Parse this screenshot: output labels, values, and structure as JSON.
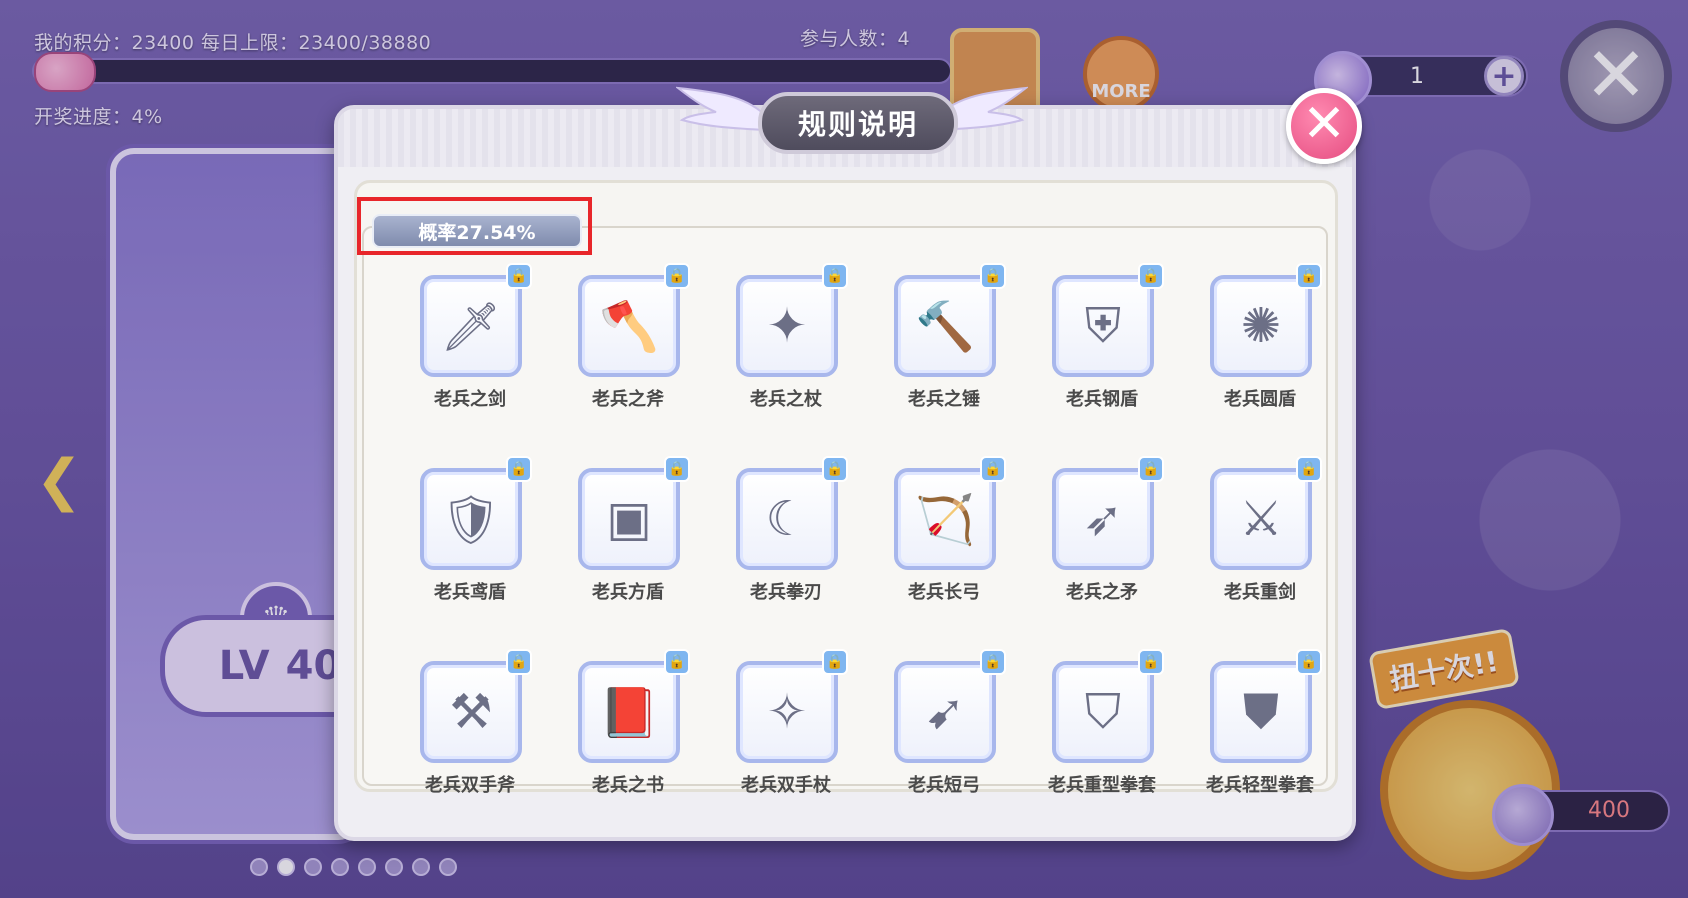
{
  "hud": {
    "score_text": "我的积分：23400 每日上限：23400/38880",
    "participants_text": "参与人数：4",
    "lottery_progress_text": "开奖进度：4%",
    "lottery_progress": 0.04,
    "more_label": "MORE",
    "currency_count": "1",
    "lv_label": "LV",
    "lv_value": "40",
    "ten_draw_label": "扭十次!!",
    "cost_value": "400"
  },
  "modal": {
    "title": "规则说明",
    "probability_label": "概率27.54%",
    "items": [
      {
        "name": "老兵之剑",
        "icon": "sword-icon"
      },
      {
        "name": "老兵之斧",
        "icon": "axe-icon"
      },
      {
        "name": "老兵之杖",
        "icon": "staff-icon"
      },
      {
        "name": "老兵之锤",
        "icon": "hammer-icon"
      },
      {
        "name": "老兵钢盾",
        "icon": "steel-shield-icon"
      },
      {
        "name": "老兵圆盾",
        "icon": "round-shield-icon"
      },
      {
        "name": "老兵鸢盾",
        "icon": "kite-shield-icon"
      },
      {
        "name": "老兵方盾",
        "icon": "square-shield-icon"
      },
      {
        "name": "老兵拳刃",
        "icon": "fist-blade-icon"
      },
      {
        "name": "老兵长弓",
        "icon": "longbow-icon"
      },
      {
        "name": "老兵之矛",
        "icon": "spear-icon"
      },
      {
        "name": "老兵重剑",
        "icon": "greatsword-icon"
      },
      {
        "name": "老兵双手斧",
        "icon": "two-handed-axe-icon"
      },
      {
        "name": "老兵之书",
        "icon": "book-icon"
      },
      {
        "name": "老兵双手杖",
        "icon": "two-handed-staff-icon"
      },
      {
        "name": "老兵短弓",
        "icon": "shortbow-icon"
      },
      {
        "name": "老兵重型拳套",
        "icon": "heavy-gauntlet-icon"
      },
      {
        "name": "老兵轻型拳套",
        "icon": "light-gauntlet-icon"
      }
    ]
  }
}
